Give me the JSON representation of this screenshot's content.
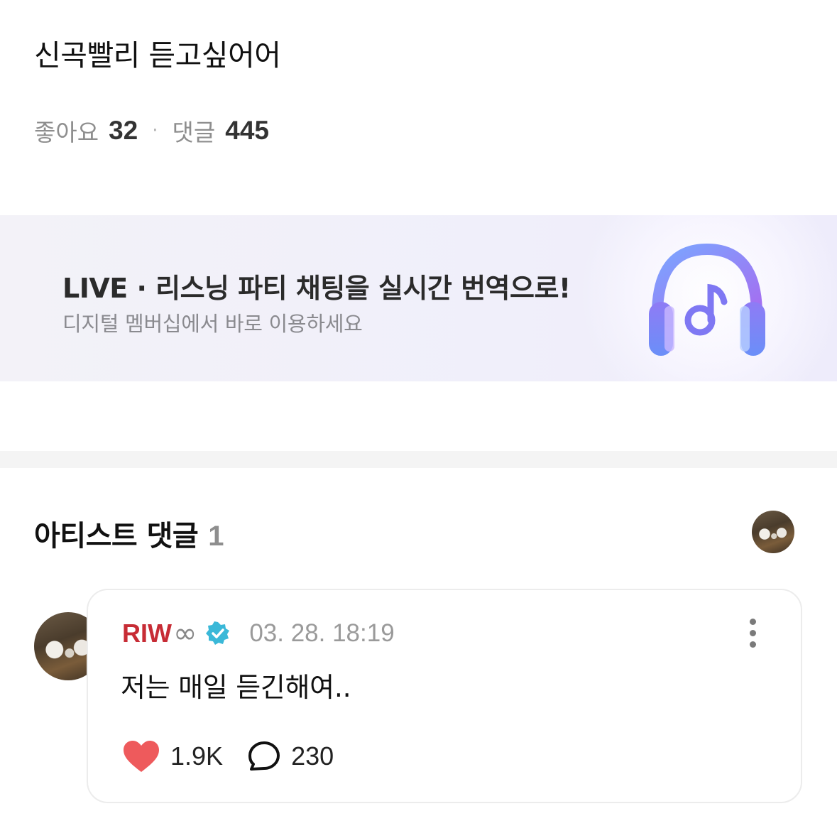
{
  "post": {
    "text": "신곡빨리 듣고싶어어",
    "likes_label": "좋아요",
    "likes_count": "32",
    "separator": "·",
    "comments_label": "댓글",
    "comments_count": "445"
  },
  "banner": {
    "title": "LIVE · 리스닝 파티 채팅을 실시간 번역으로!",
    "subtitle": "디지털 멤버십에서 바로 이용하세요",
    "icon": "headphones-music-icon"
  },
  "artist_comments": {
    "title": "아티스트 댓글",
    "count": "1",
    "avatar_icon": "artist-avatar"
  },
  "comment": {
    "author": "RIW",
    "author_suffix": "∞",
    "verified_icon": "verified-badge-icon",
    "timestamp": "03. 28. 18:19",
    "body": "저는 매일 듣긴해여..",
    "like_count": "1.9K",
    "reply_count": "230",
    "like_icon": "heart-icon",
    "reply_icon": "speech-bubble-icon",
    "more_icon": "more-vertical-icon"
  },
  "colors": {
    "author_name": "#c72c35",
    "heart": "#ee5a5c",
    "verified": "#3ab8d8",
    "headphone_gradient_start": "#6fa0ff",
    "headphone_gradient_end": "#a56cf0"
  }
}
